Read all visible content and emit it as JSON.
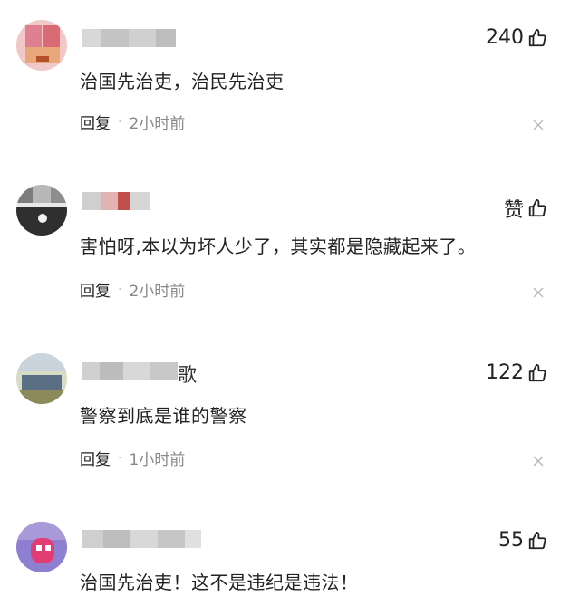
{
  "comments": [
    {
      "like_count": "240",
      "text": "治国先治吏，治民先治吏",
      "reply_label": "回复",
      "time": "2小时前"
    },
    {
      "like_count": "赞",
      "text": "害怕呀,本以为坏人少了，其实都是隐藏起来了。",
      "reply_label": "回复",
      "time": "2小时前"
    },
    {
      "name_suffix": "歌",
      "like_count": "122",
      "text": "警察到底是谁的警察",
      "reply_label": "回复",
      "time": "1小时前"
    },
    {
      "like_count": "55",
      "text": "治国先治吏！这不是违纪是违法！"
    }
  ],
  "icons": {
    "like": "thumbs-up-icon",
    "close": "close-icon"
  },
  "colors": {
    "text": "#222222",
    "time": "#888888",
    "close": "#bbbbbb"
  }
}
